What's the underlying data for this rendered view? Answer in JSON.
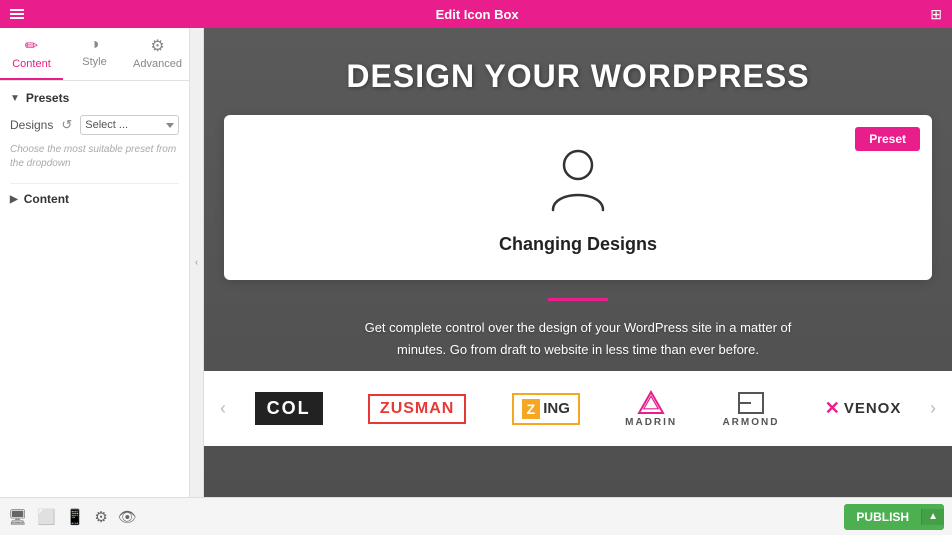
{
  "topbar": {
    "title": "Edit Icon Box",
    "menu_icon": "menu-icon",
    "grid_icon": "grid-icon"
  },
  "sidebar": {
    "tabs": [
      {
        "id": "content",
        "label": "Content",
        "icon": "✏️",
        "active": true
      },
      {
        "id": "style",
        "label": "Style",
        "icon": "🎨",
        "active": false
      },
      {
        "id": "advanced",
        "label": "Advanced",
        "icon": "⚙️",
        "active": false
      }
    ],
    "presets": {
      "header": "Presets",
      "designs_label": "Designs",
      "select_placeholder": "Select ...",
      "hint": "Choose the most suitable preset from the dropdown"
    },
    "content_section": {
      "header": "Content"
    }
  },
  "canvas": {
    "hero_title": "DESIGN YOUR WORDPRESS",
    "icon_box": {
      "title": "Changing Designs",
      "preset_btn": "Preset"
    },
    "mid_text": "Get complete control over the design of your WordPress site in a matter of\nminutes. Go from draft to website in less time than ever before.",
    "logos": [
      {
        "id": "col",
        "text": "COL",
        "type": "col"
      },
      {
        "id": "zusman",
        "text": "ZUSMAN",
        "type": "zusman"
      },
      {
        "id": "zing",
        "z": "Z",
        "text": "ING",
        "type": "zing"
      },
      {
        "id": "madrin",
        "icon": "◈",
        "text": "MADRIN",
        "type": "madrin"
      },
      {
        "id": "armond",
        "icon": "⊢",
        "text": "ARMOND",
        "type": "armond"
      },
      {
        "id": "venox",
        "x": "✕",
        "text": "VENOX",
        "type": "venox"
      }
    ]
  },
  "bottombar": {
    "publish_label": "PUBLISH",
    "icons": [
      "desktop-icon",
      "tablet-icon",
      "mobile-icon",
      "settings-icon",
      "eye-icon"
    ]
  }
}
